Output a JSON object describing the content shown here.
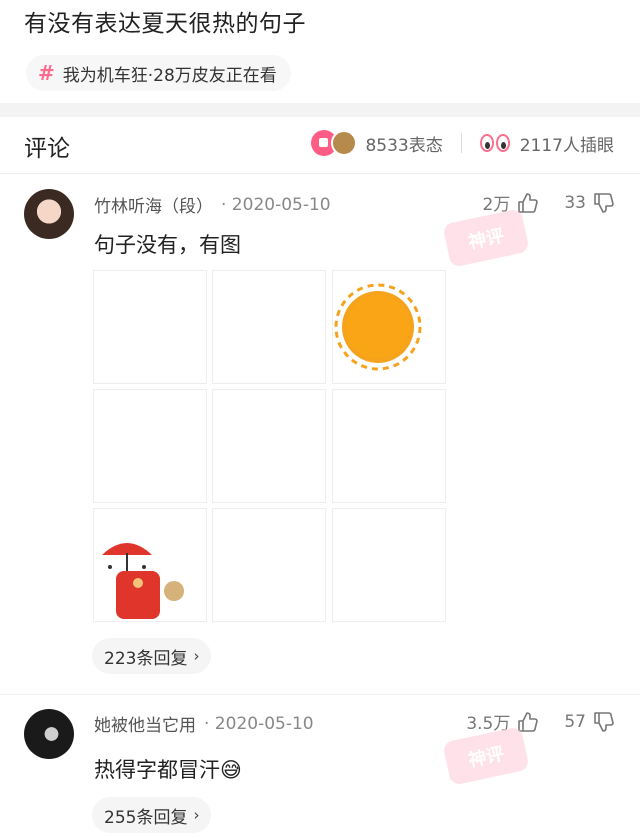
{
  "post": {
    "title": "有没有表达夏天很热的句子",
    "topic": "我为机车狂·28万皮友正在看"
  },
  "comments_header": {
    "title": "评论",
    "reactions_count": "8533表态",
    "inserted_eyes_count": "2117人插眼"
  },
  "comments": [
    {
      "author": "竹林听海（段）",
      "date": "· 2020-05-10",
      "likes": "2万",
      "dislikes": "33",
      "text": "句子没有，有图",
      "replies": "223条回复",
      "stamp": "神评"
    },
    {
      "author": "她被他当它用",
      "date": "· 2020-05-10",
      "likes": "3.5万",
      "dislikes": "57",
      "text": "热得字都冒汗😅",
      "replies": "255条回复",
      "stamp": "神评"
    }
  ],
  "colors": {
    "accent_pink": "#ff5c86",
    "sun_orange": "#f5a21c",
    "umbrella_red": "#e0352b"
  }
}
